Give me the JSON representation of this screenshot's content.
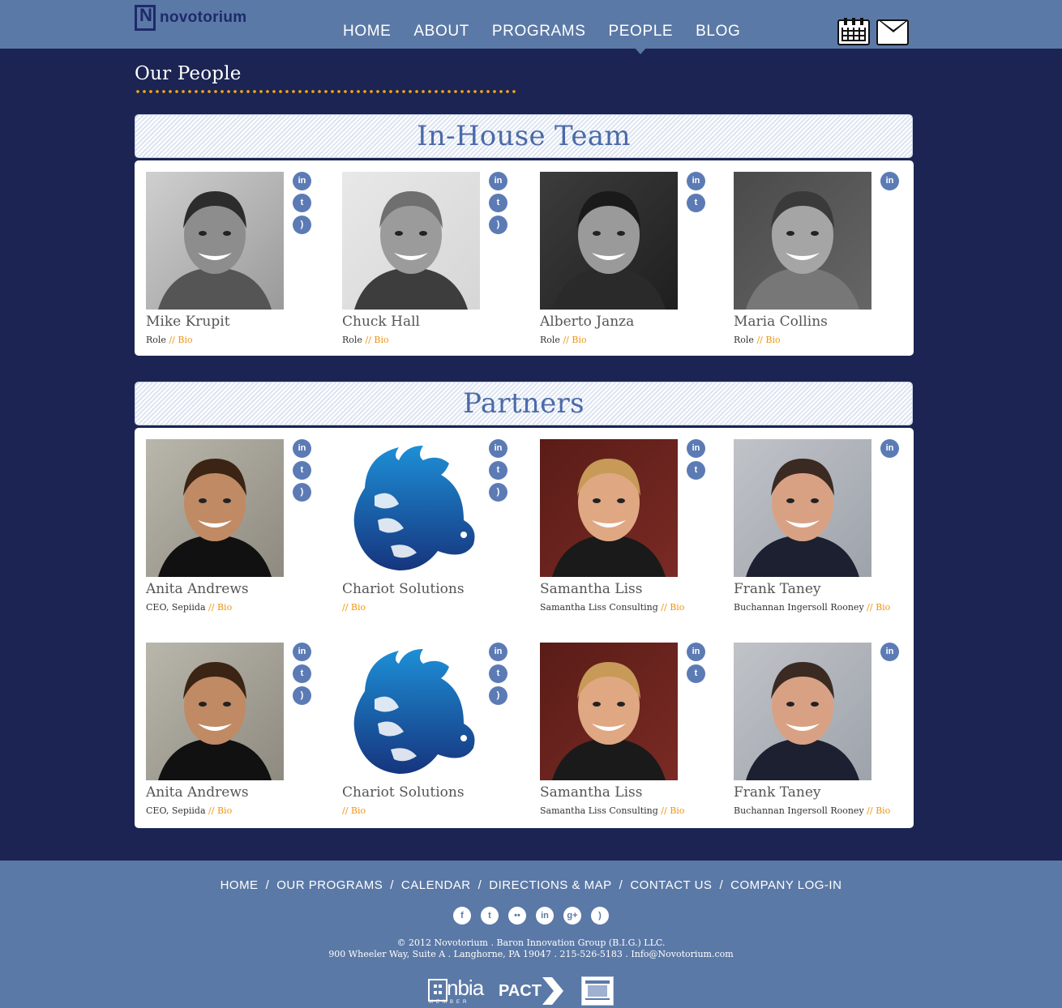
{
  "brand": {
    "name": "novotorium"
  },
  "nav": [
    {
      "label": "HOME"
    },
    {
      "label": "ABOUT"
    },
    {
      "label": "PROGRAMS"
    },
    {
      "label": "PEOPLE",
      "active": true
    },
    {
      "label": "BLOG"
    }
  ],
  "header_icons": [
    "calendar-icon",
    "mail-icon"
  ],
  "page": {
    "title": "Our People"
  },
  "sections": {
    "inhouse": {
      "title": "In-House Team",
      "people": [
        {
          "name": "Mike Krupit",
          "role": "Role",
          "sep": "//",
          "link": "Bio",
          "social": [
            "linkedin",
            "twitter",
            "rss"
          ]
        },
        {
          "name": "Chuck Hall",
          "role": "Role",
          "sep": "//",
          "link": "Bio",
          "social": [
            "linkedin",
            "twitter",
            "rss"
          ]
        },
        {
          "name": "Alberto Janza",
          "role": "Role",
          "sep": "//",
          "link": "Bio",
          "social": [
            "linkedin",
            "twitter"
          ]
        },
        {
          "name": "Maria Collins",
          "role": "Role",
          "sep": "//",
          "link": "Bio",
          "social": [
            "linkedin"
          ]
        }
      ]
    },
    "partners": {
      "title": "Partners",
      "people": [
        {
          "name": "Anita Andrews",
          "role": "CEO, Sepiida",
          "sep": "//",
          "link": "Bio",
          "social": [
            "linkedin",
            "twitter",
            "rss"
          ]
        },
        {
          "name": "Chariot Solutions",
          "role": "",
          "sep": "//",
          "link": "Bio",
          "social": [
            "linkedin",
            "twitter",
            "rss"
          ]
        },
        {
          "name": "Samantha Liss",
          "role": "Samantha Liss Consulting",
          "sep": "//",
          "link": "Bio",
          "social": [
            "linkedin",
            "twitter"
          ]
        },
        {
          "name": "Frank Taney",
          "role": "Buchannan Ingersoll Rooney",
          "sep": "//",
          "link": "Bio",
          "social": [
            "linkedin"
          ]
        },
        {
          "name": "Anita Andrews",
          "role": "CEO, Sepiida",
          "sep": "//",
          "link": "Bio",
          "social": [
            "linkedin",
            "twitter",
            "rss"
          ]
        },
        {
          "name": "Chariot Solutions",
          "role": "",
          "sep": "//",
          "link": "Bio",
          "social": [
            "linkedin",
            "twitter",
            "rss"
          ]
        },
        {
          "name": "Samantha Liss",
          "role": "Samantha Liss Consulting",
          "sep": "//",
          "link": "Bio",
          "social": [
            "linkedin",
            "twitter"
          ]
        },
        {
          "name": "Frank Taney",
          "role": "Buchannan Ingersoll Rooney",
          "sep": "//",
          "link": "Bio",
          "social": [
            "linkedin"
          ]
        }
      ]
    }
  },
  "footer": {
    "nav": [
      "HOME",
      "OUR PROGRAMS",
      "CALENDAR",
      "DIRECTIONS & MAP",
      "CONTACT US",
      "COMPANY LOG-IN"
    ],
    "nav_separator": "/",
    "social": [
      "facebook",
      "twitter",
      "flickr",
      "linkedin",
      "google-plus",
      "rss"
    ],
    "copyright": "© 2012 Novotorium . Baron Innovation Group (B.I.G.) LLC.",
    "address": "900 Wheeler Way, Suite A . Langhorne, PA 19047 . 215-526-5183 . Info@Novotorium.com",
    "logos": {
      "nbia": "nbia",
      "nbia_sub": "MEMBER",
      "pact": "PACT"
    }
  },
  "colors": {
    "header_bg": "#5b79a6",
    "page_bg": "#1b2452",
    "accent_orange": "#f0940e",
    "title_blue": "#4b6aa8",
    "icon_blue": "#5c7bb5"
  }
}
